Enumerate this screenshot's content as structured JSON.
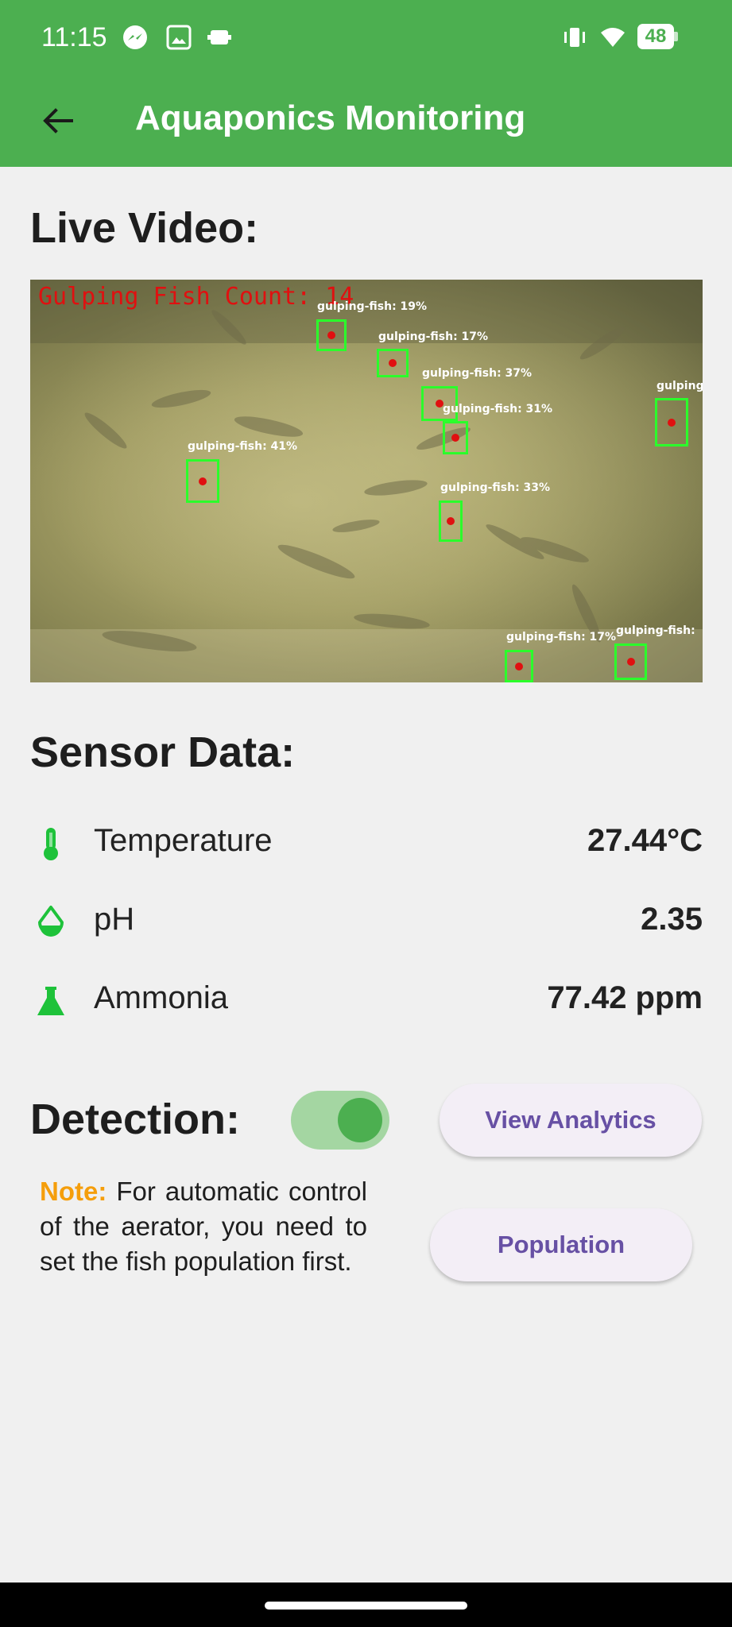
{
  "status_bar": {
    "time": "11:15",
    "battery": "48",
    "left_icons": [
      "messenger-icon",
      "gallery-icon",
      "usb-icon"
    ],
    "right_icons": [
      "vibrate-icon",
      "wifi-icon",
      "battery-icon"
    ]
  },
  "app_bar": {
    "title": "Aquaponics Monitoring",
    "back_icon": "arrow-back-icon"
  },
  "live_video": {
    "title": "Live Video:",
    "count_overlay": "Gulping Fish Count: 14",
    "detections": [
      {
        "label": "gulping-fish: 19%"
      },
      {
        "label": "gulping-fish: 17%"
      },
      {
        "label": "gulping-fish: 37%"
      },
      {
        "label": "gulping-fish: 31%"
      },
      {
        "label": "gulping"
      },
      {
        "label": "gulping-fish: 41%"
      },
      {
        "label": "gulping-fish: 33%"
      },
      {
        "label": "gulping-fish: 17%"
      },
      {
        "label": "gulping-fish:"
      }
    ]
  },
  "sensor_data": {
    "title": "Sensor Data:",
    "rows": [
      {
        "label": "Temperature",
        "value": "27.44°C",
        "icon": "thermometer-icon"
      },
      {
        "label": "pH",
        "value": "2.35",
        "icon": "water-drop-icon"
      },
      {
        "label": "Ammonia",
        "value": "77.42 ppm",
        "icon": "flask-icon"
      }
    ]
  },
  "detection": {
    "title": "Detection:",
    "toggle_on": true,
    "note_label": "Note:",
    "note_text": "For automatic control of the aerator, you need to set the fish population first."
  },
  "buttons": {
    "view_analytics": "View Analytics",
    "population": "Population"
  },
  "colors": {
    "primary": "#4caf50",
    "button_text": "#6750a4",
    "note_accent": "#f59e0b",
    "detection_box": "#2bff2b",
    "overlay_red": "#e01010"
  }
}
